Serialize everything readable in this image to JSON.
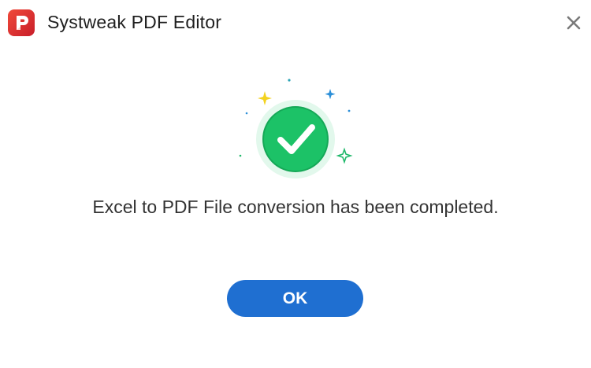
{
  "window": {
    "title": "Systweak PDF Editor",
    "logo_icon": "systweak-pdf-logo",
    "close_icon": "close-icon"
  },
  "dialog": {
    "status_icon": "success-check-icon",
    "message": "Excel to PDF File conversion has been completed.",
    "ok_label": "OK"
  },
  "colors": {
    "brand": "#e8312f",
    "accent_button": "#1f6fd1",
    "success": "#1fc46a"
  }
}
